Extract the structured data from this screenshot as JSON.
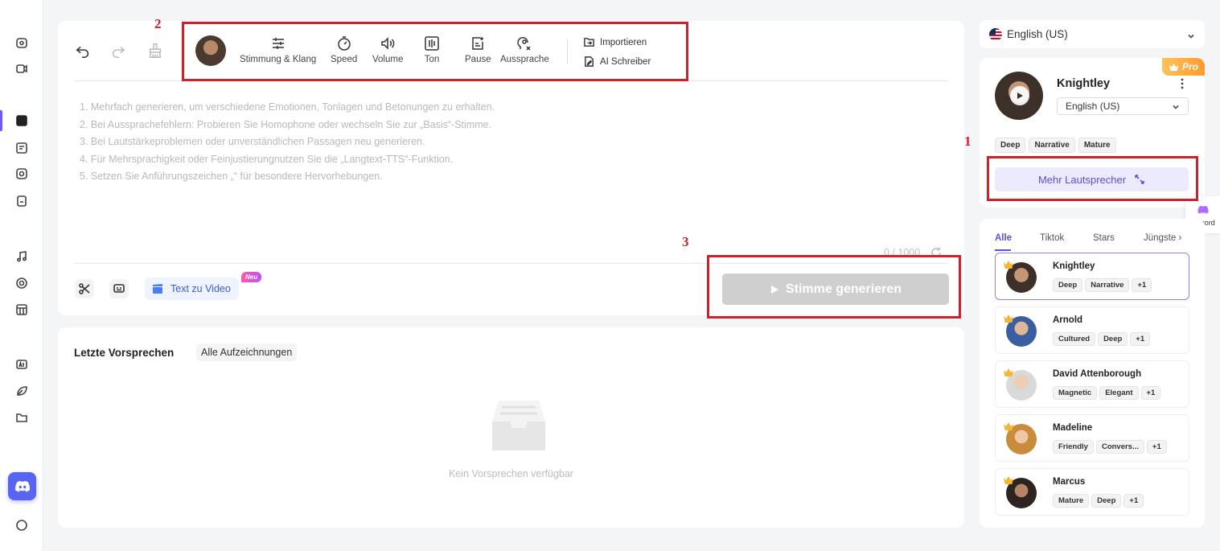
{
  "toolbar": {
    "items": [
      {
        "label": "Stimmung & Klang",
        "icon": "sliders-icon"
      },
      {
        "label": "Speed",
        "icon": "timer-icon"
      },
      {
        "label": "Volume",
        "icon": "speaker-icon"
      },
      {
        "label": "Ton",
        "icon": "equalizer-icon"
      },
      {
        "label": "Pause",
        "icon": "pause-insert-icon"
      },
      {
        "label": "Aussprache",
        "icon": "pronunciation-icon"
      }
    ],
    "import_label": "Importieren",
    "ai_writer_label": "AI Schreiber"
  },
  "editor": {
    "tips": [
      "1. Mehrfach generieren, um verschiedene Emotionen, Tonlagen und Betonungen zu erhalten.",
      "2. Bei Aussprachefehlern: Probieren Sie Homophone oder wechseln Sie zur „Basis“-Stimme.",
      "3. Bei Lautstärkeproblemen oder unverständlichen Passagen neu generieren.",
      "4. Für Mehrsprachigkeit oder Feinjustierungnutzen Sie die „Langtext-TTS“-Funktion.",
      "5. Setzen Sie Anführungszeichen „“ für besondere Hervorhebungen."
    ],
    "counter": "0 / 1000",
    "text_to_video_label": "Text zu Video",
    "new_badge": "Neu",
    "generate_label": "Stimme generieren"
  },
  "recent": {
    "title": "Letzte Vorsprechen",
    "all_records": "Alle Aufzeichnungen",
    "empty_text": "Kein Vorsprechen verfügbar"
  },
  "language": {
    "selected": "English (US)"
  },
  "speaker": {
    "badge": "Pro",
    "name": "Knightley",
    "language": "English (US)",
    "tags": [
      "Deep",
      "Narrative",
      "Mature"
    ],
    "more_label": "Mehr Lautsprecher"
  },
  "discord_label": "Discord",
  "voice_tabs": [
    "Alle",
    "Tiktok",
    "Stars",
    "Jüngste"
  ],
  "voices": [
    {
      "name": "Knightley",
      "tags": [
        "Deep",
        "Narrative",
        "+1"
      ]
    },
    {
      "name": "Arnold",
      "tags": [
        "Cultured",
        "Deep",
        "+1"
      ]
    },
    {
      "name": "David Attenborough",
      "tags": [
        "Magnetic",
        "Elegant",
        "+1"
      ]
    },
    {
      "name": "Madeline",
      "tags": [
        "Friendly",
        "Convers...",
        "+1"
      ]
    },
    {
      "name": "Marcus",
      "tags": [
        "Mature",
        "Deep",
        "+1"
      ]
    }
  ],
  "annotations": [
    "1",
    "2",
    "3"
  ],
  "colors": {
    "accent": "#5a4fd6",
    "annotation_red": "#d0202b",
    "discord": "#5865f2",
    "pro_badge": "#ff9a2e"
  }
}
